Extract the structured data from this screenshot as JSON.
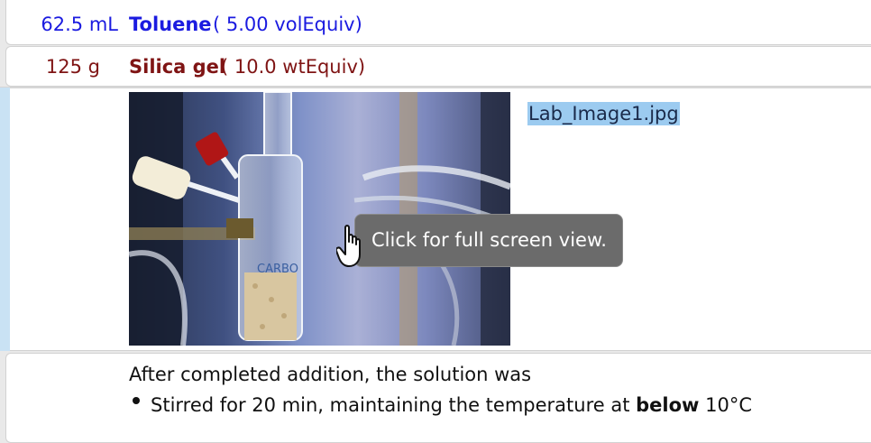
{
  "reagents": [
    {
      "amount": "62.5 mL",
      "name": "Toluene",
      "equiv": "( 5.00 volEquiv)",
      "color": "#1b1be0"
    },
    {
      "amount": "125 g",
      "name": "Silica gel",
      "equiv": "( 10.0 wtEquiv)",
      "color": "#7f1414"
    }
  ],
  "image_block": {
    "filename": "Lab_Image1.jpg",
    "tooltip": "Click for full screen view.",
    "photo_text": "CARBO"
  },
  "procedure": {
    "line1": "After completed addition, the solution was",
    "bullet_pre": "Stirred for 20 min, maintaining the temperature at ",
    "bullet_bold": "below",
    "bullet_post": " 10°C"
  }
}
